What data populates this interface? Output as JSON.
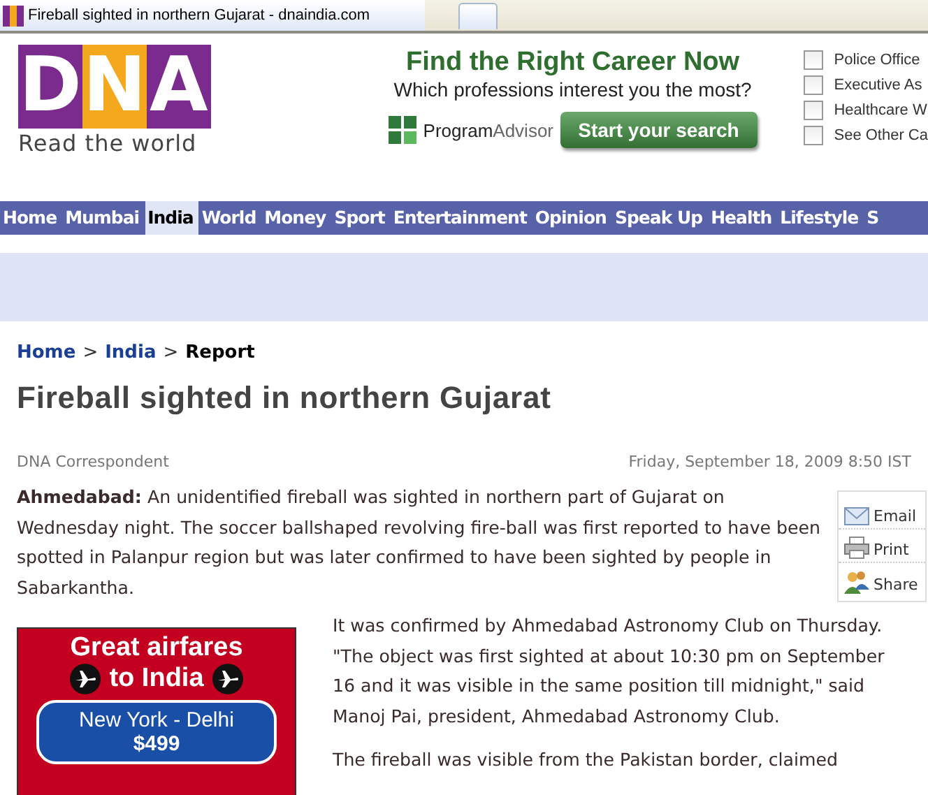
{
  "browser_tab": {
    "title": "Fireball sighted in northern Gujarat - dnaindia.com"
  },
  "logo": {
    "letters": [
      "D",
      "N",
      "A"
    ],
    "tagline": "Read the world"
  },
  "career_ad": {
    "heading": "Find the Right Career Now",
    "question": "Which professions interest you the most?",
    "brand_a": "Program",
    "brand_b": "Advisor",
    "button": "Start your search",
    "options": [
      {
        "label": "Police Office",
        "checked": false
      },
      {
        "label": "Executive As",
        "checked": false
      },
      {
        "label": "Healthcare W",
        "checked": false
      },
      {
        "label": "See Other Ca",
        "checked": false
      }
    ]
  },
  "nav": [
    {
      "label": "Home",
      "selected": false
    },
    {
      "label": "Mumbai",
      "selected": false
    },
    {
      "label": "India",
      "selected": true
    },
    {
      "label": "World",
      "selected": false
    },
    {
      "label": "Money",
      "selected": false
    },
    {
      "label": "Sport",
      "selected": false
    },
    {
      "label": "Entertainment",
      "selected": false
    },
    {
      "label": "Opinion",
      "selected": false
    },
    {
      "label": "Speak Up",
      "selected": false
    },
    {
      "label": "Health",
      "selected": false
    },
    {
      "label": "Lifestyle",
      "selected": false
    },
    {
      "label": "S",
      "selected": false
    }
  ],
  "breadcrumb": [
    {
      "label": "Home",
      "kind": "link"
    },
    {
      "label": ">",
      "kind": "sep"
    },
    {
      "label": "India",
      "kind": "link"
    },
    {
      "label": ">",
      "kind": "sep"
    },
    {
      "label": "Report",
      "kind": "current"
    }
  ],
  "article": {
    "headline": "Fireball sighted in northern Gujarat",
    "author": "DNA Correspondent",
    "date": "Friday, September 18, 2009 8:50 IST",
    "paragraphs": [
      "**Ahmedabad:** An unidentified fireball was sighted in northern part of Gujarat on Wednesday night. The soccer ballshaped revolving fire-ball was first reported to have been spotted in Palanpur region but was later confirmed to have been sighted by people in Sabarkantha.",
      "It was confirmed by Ahmedabad Astronomy Club on Thursday. \"The object was first sighted at about 10:30 pm on September 16 and it was visible in the same position till midnight,\" said Manoj Pai, president, Ahmedabad Astronomy Club.",
      "The fireball was visible from the Pakistan border, claimed"
    ]
  },
  "share_tools": [
    {
      "kind": "email",
      "label": "Email"
    },
    {
      "kind": "print",
      "label": "Print"
    },
    {
      "kind": "share",
      "label": "Share"
    }
  ],
  "fare_ad": {
    "line1": "Great airfares",
    "line2": "to India",
    "route": "New York - Delhi",
    "price": "$499"
  }
}
